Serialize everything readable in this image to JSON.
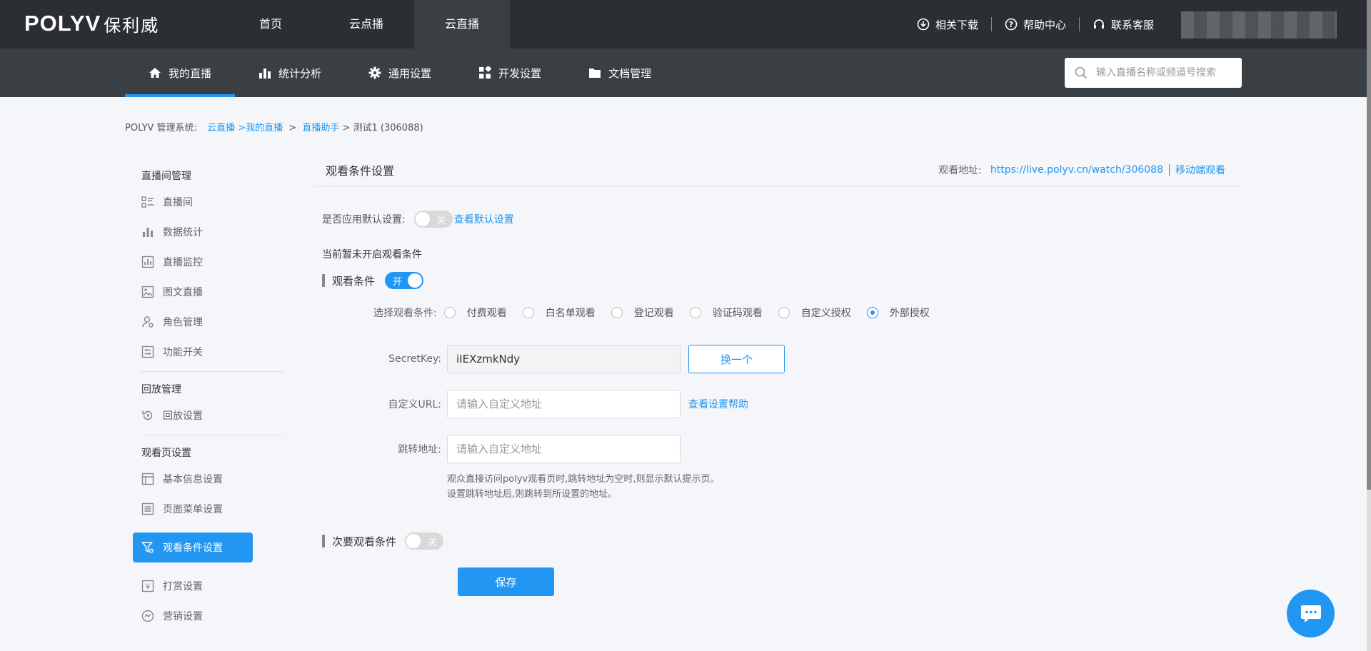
{
  "brand": {
    "logo_text": "POLYV",
    "logo_cn": "保利威"
  },
  "topnav": [
    {
      "label": "首页",
      "active": false
    },
    {
      "label": "云点播",
      "active": false
    },
    {
      "label": "云直播",
      "active": true
    }
  ],
  "toplinks": [
    {
      "label": "相关下载",
      "icon": "download-icon"
    },
    {
      "label": "帮助中心",
      "icon": "help-icon"
    },
    {
      "label": "联系客服",
      "icon": "headset-icon"
    }
  ],
  "subnav": [
    {
      "label": "我的直播",
      "icon": "home-icon",
      "active": true
    },
    {
      "label": "统计分析",
      "icon": "bar-chart-icon",
      "active": false
    },
    {
      "label": "通用设置",
      "icon": "gear-icon",
      "active": false
    },
    {
      "label": "开发设置",
      "icon": "grid-icon",
      "active": false
    },
    {
      "label": "文档管理",
      "icon": "folder-icon",
      "active": false
    }
  ],
  "search": {
    "placeholder": "输入直播名称或频道号搜索"
  },
  "breadcrumb": {
    "prefix": "POLYV 管理系统:",
    "items": [
      "云直播",
      ">我的直播",
      ">",
      "直播助手",
      "> 测试1 (306088)"
    ]
  },
  "sidebar": {
    "groups": [
      {
        "title": "直播间管理",
        "items": [
          "直播间",
          "数据统计",
          "直播监控",
          "图文直播",
          "角色管理",
          "功能开关"
        ]
      },
      {
        "title": "回放管理",
        "items": [
          "回放设置"
        ]
      },
      {
        "title": "观看页设置",
        "items": [
          "基本信息设置",
          "页面菜单设置",
          "观看条件设置",
          "打赏设置",
          "营销设置"
        ]
      }
    ],
    "active_item": "观看条件设置"
  },
  "content": {
    "title": "观看条件设置",
    "watch_url_label": "观看地址:",
    "watch_url": "https://live.polyv.cn/watch/306088",
    "mobile_watch": "移动端观看",
    "apply_default_label": "是否应用默认设置:",
    "apply_default_toggle": "关",
    "view_default_link": "查看默认设置",
    "status_text": "当前暂未开启观看条件",
    "primary_condition_label": "观看条件",
    "primary_condition_toggle": "开",
    "select_condition_label": "选择观看条件:",
    "conditions": [
      {
        "label": "付费观看",
        "checked": false
      },
      {
        "label": "白名单观看",
        "checked": false
      },
      {
        "label": "登记观看",
        "checked": false
      },
      {
        "label": "验证码观看",
        "checked": false
      },
      {
        "label": "自定义授权",
        "checked": false
      },
      {
        "label": "外部授权",
        "checked": true
      }
    ],
    "secret_key_label": "SecretKey:",
    "secret_key_value": "iIEXzmkNdy",
    "regenerate_button": "换一个",
    "custom_url_label": "自定义URL:",
    "custom_url_placeholder": "请输入自定义地址",
    "setup_help_link": "查看设置帮助",
    "redirect_label": "跳转地址:",
    "redirect_placeholder": "请输入自定义地址",
    "hint_line1": "观众直接访问polyv观看页时,跳转地址为空时,则显示默认提示页。",
    "hint_line2": "设置跳转地址后,则跳转到所设置的地址。",
    "secondary_condition_label": "次要观看条件",
    "secondary_condition_toggle": "关",
    "save_button": "保存"
  },
  "colors": {
    "accent": "#2196f3",
    "topbar": "#2b2f33",
    "subbar": "#3a3f44"
  }
}
